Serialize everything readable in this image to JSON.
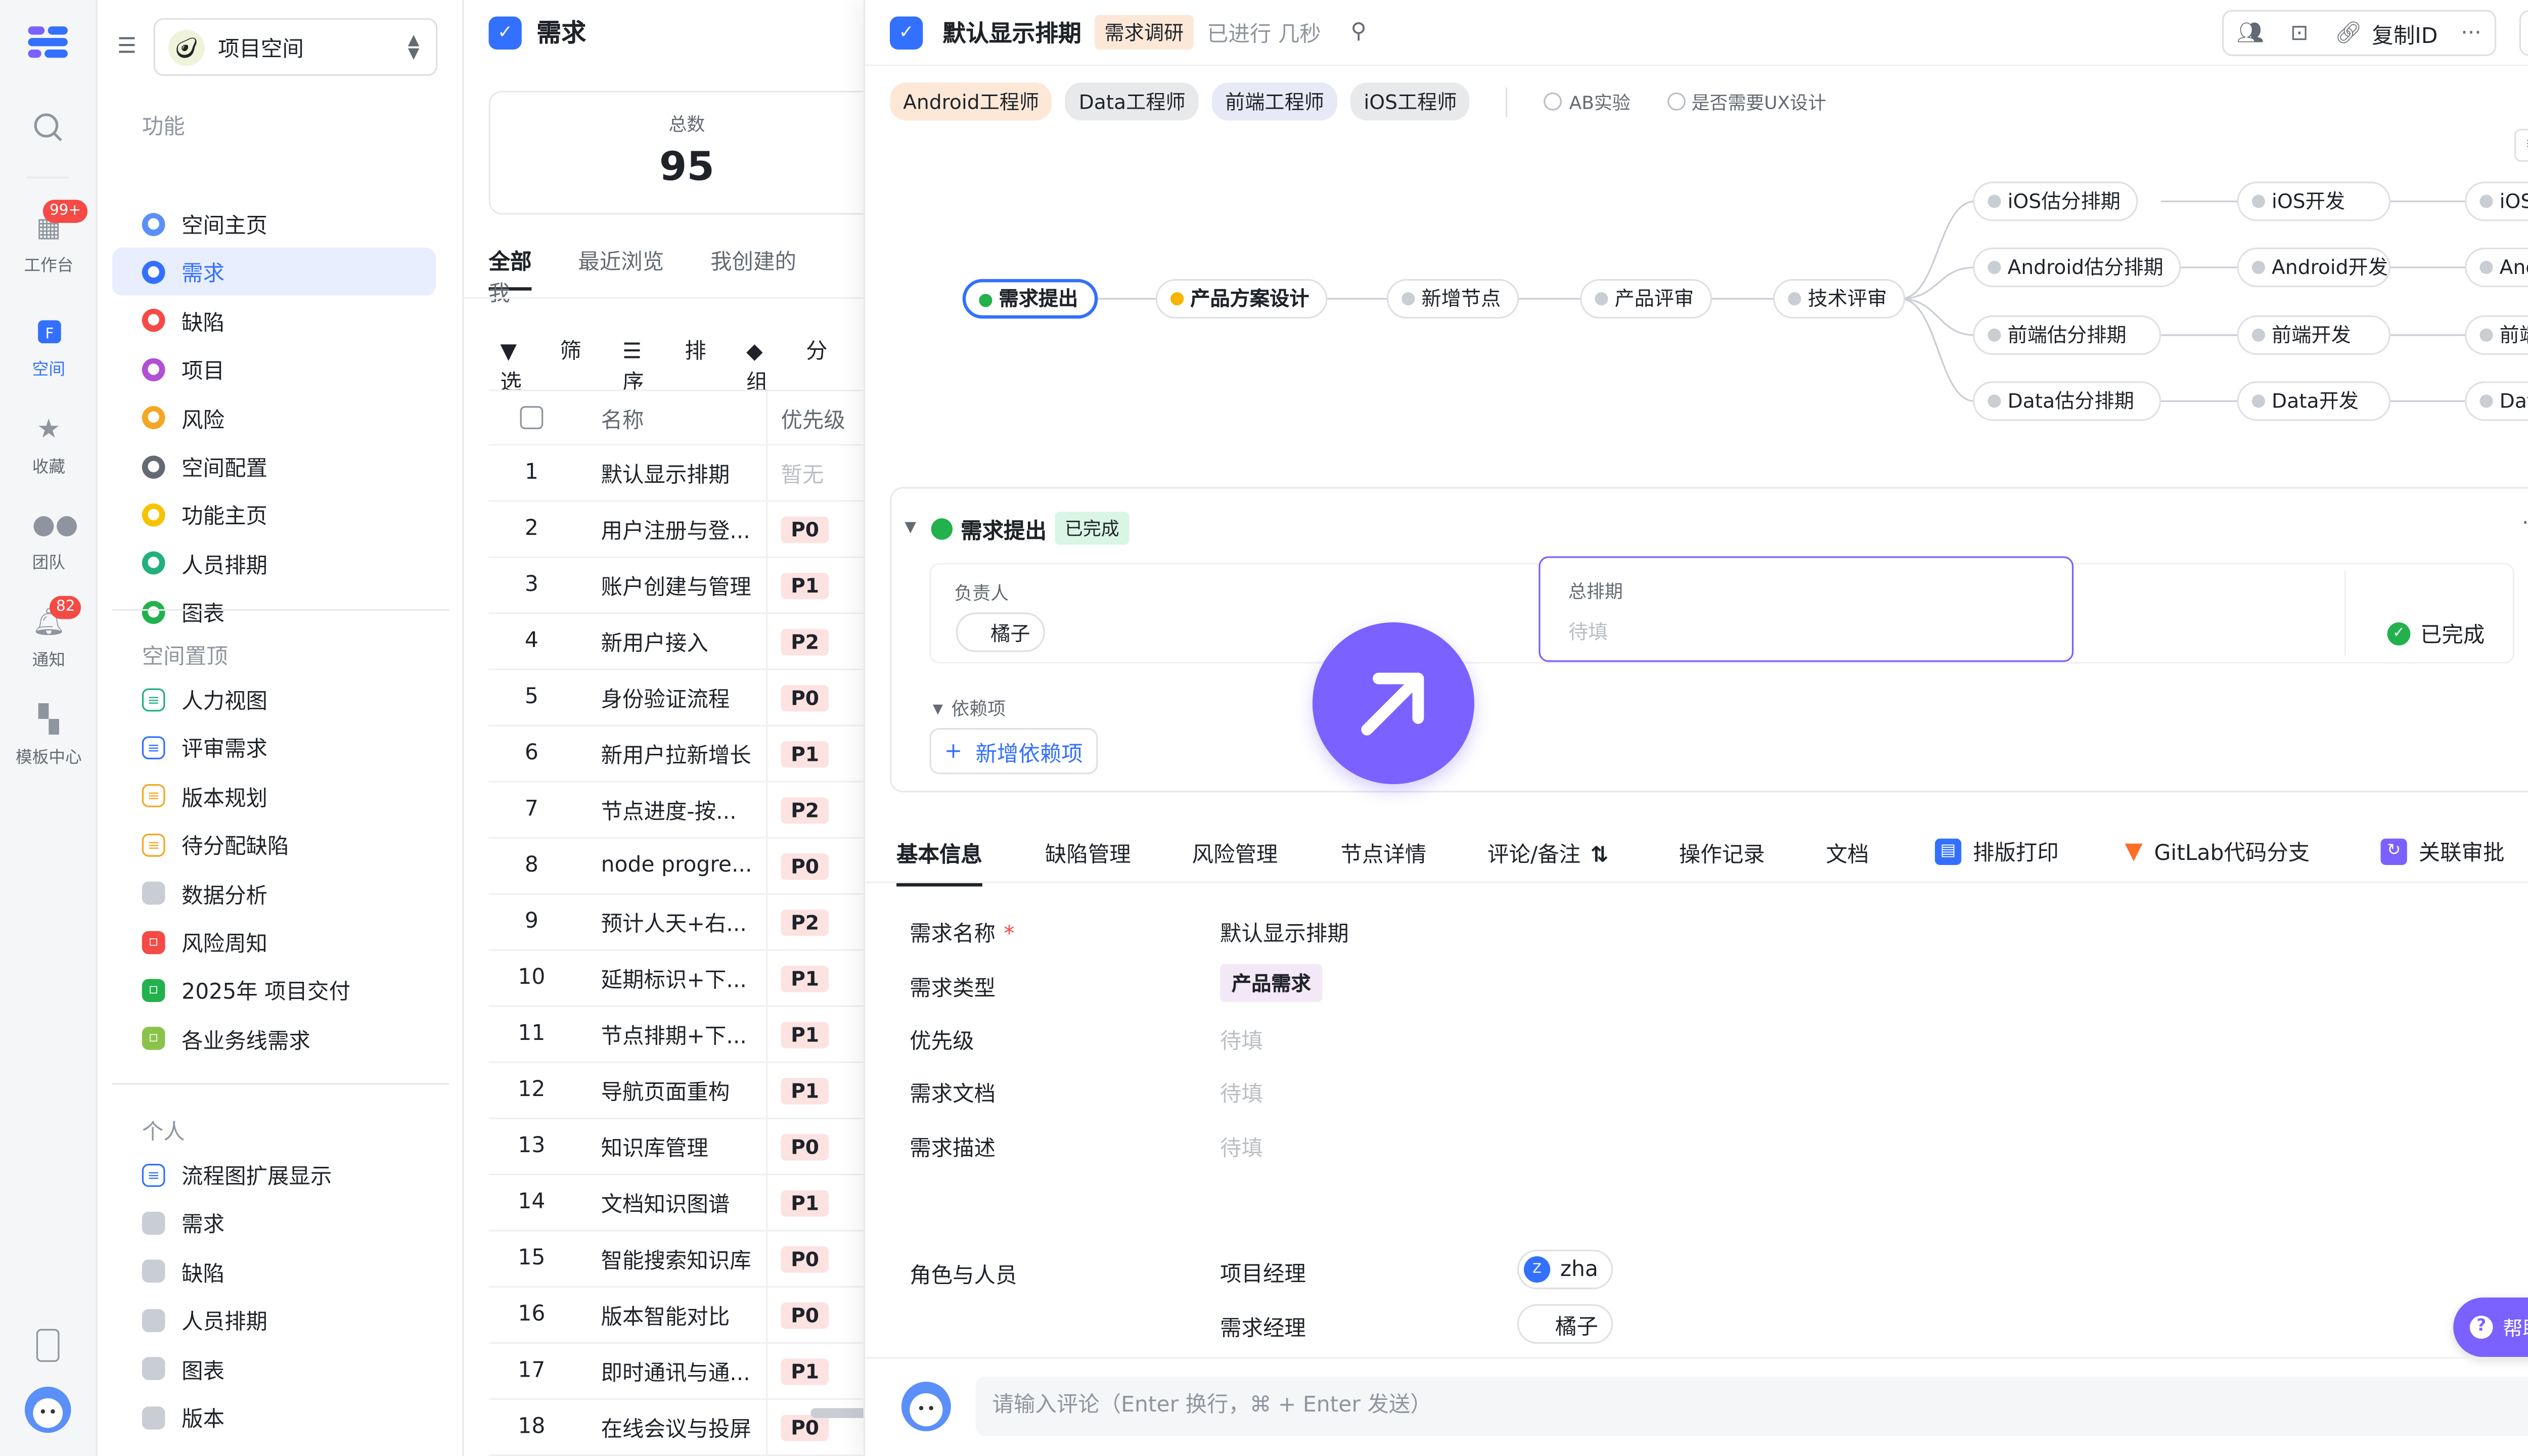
{
  "rail": {
    "items": [
      {
        "label": "工作台",
        "badge": "99+"
      },
      {
        "label": "空间"
      },
      {
        "label": "收藏"
      },
      {
        "label": "团队"
      },
      {
        "label": "通知",
        "badge": "82"
      },
      {
        "label": "模板中心"
      }
    ]
  },
  "sidebar": {
    "space_name": "项目空间",
    "sections": {
      "features": "功能",
      "pinned": "空间置顶",
      "personal": "个人"
    },
    "features": [
      {
        "label": "空间主页"
      },
      {
        "label": "需求"
      },
      {
        "label": "缺陷"
      },
      {
        "label": "项目"
      },
      {
        "label": "风险"
      },
      {
        "label": "空间配置"
      },
      {
        "label": "功能主页"
      },
      {
        "label": "人员排期"
      },
      {
        "label": "图表"
      }
    ],
    "pinned": [
      {
        "label": "人力视图"
      },
      {
        "label": "评审需求"
      },
      {
        "label": "版本规划"
      },
      {
        "label": "待分配缺陷"
      },
      {
        "label": "数据分析"
      },
      {
        "label": "风险周知"
      },
      {
        "label": "2025年 项目交付"
      },
      {
        "label": "各业务线需求"
      }
    ],
    "personal": [
      {
        "label": "流程图扩展显示"
      },
      {
        "label": "需求"
      },
      {
        "label": "缺陷"
      },
      {
        "label": "人员排期"
      },
      {
        "label": "图表"
      },
      {
        "label": "版本"
      }
    ]
  },
  "list": {
    "title": "需求",
    "stat_label": "总数",
    "stat_value": "95",
    "tabs": [
      "全部",
      "最近浏览",
      "我创建的",
      "我"
    ],
    "tools": [
      "筛选",
      "排序",
      "分组"
    ],
    "col_name": "名称",
    "col_priority": "优先级",
    "rows": [
      {
        "no": "1",
        "name": "默认显示排期",
        "pri": "暂无"
      },
      {
        "no": "2",
        "name": "用户注册与登...",
        "pri": "P0"
      },
      {
        "no": "3",
        "name": "账户创建与管理",
        "pri": "P1"
      },
      {
        "no": "4",
        "name": "新用户接入",
        "pri": "P2"
      },
      {
        "no": "5",
        "name": "身份验证流程",
        "pri": "P0"
      },
      {
        "no": "6",
        "name": "新用户拉新增长",
        "pri": "P1"
      },
      {
        "no": "7",
        "name": "节点进度-按...",
        "pri": "P2"
      },
      {
        "no": "8",
        "name": "node progre...",
        "pri": "P0"
      },
      {
        "no": "9",
        "name": "预计人天+右...",
        "pri": "P2"
      },
      {
        "no": "10",
        "name": "延期标识+下...",
        "pri": "P1"
      },
      {
        "no": "11",
        "name": "节点排期+下...",
        "pri": "P1"
      },
      {
        "no": "12",
        "name": "导航页面重构",
        "pri": "P1"
      },
      {
        "no": "13",
        "name": "知识库管理",
        "pri": "P0"
      },
      {
        "no": "14",
        "name": "文档知识图谱",
        "pri": "P1"
      },
      {
        "no": "15",
        "name": "智能搜索知识库",
        "pri": "P0"
      },
      {
        "no": "16",
        "name": "版本智能对比",
        "pri": "P0"
      },
      {
        "no": "17",
        "name": "即时通讯与通...",
        "pri": "P1"
      },
      {
        "no": "18",
        "name": "在线会议与投屏",
        "pri": "P0"
      }
    ]
  },
  "detail": {
    "title": "默认显示排期",
    "stage_chip": "需求调研",
    "elapsed": "已进行 几秒",
    "copy_id": "复制ID",
    "role_chips": [
      "Android工程师",
      "Data工程师",
      "前端工程师",
      "iOS工程师"
    ],
    "options": [
      "AB实验",
      "是否需要UX设计"
    ],
    "flow": {
      "main": [
        "需求提出",
        "产品方案设计",
        "新增节点",
        "产品评审",
        "技术评审"
      ],
      "branches": [
        [
          "iOS估分排期",
          "iOS开发",
          "iOS测试"
        ],
        [
          "Android估分排期",
          "Android开发",
          "Android测试"
        ],
        [
          "前端估分排期",
          "前端开发",
          "前端测试"
        ],
        [
          "Data估分排期",
          "Data开发",
          "Data测试"
        ]
      ]
    },
    "node_card": {
      "title": "需求提出",
      "status": "已完成",
      "owner_label": "负责人",
      "owner": "橘子",
      "schedule_label": "总排期",
      "schedule_ph": "待填",
      "done": "已完成",
      "deps_label": "依赖项",
      "add_dep": "新增依赖项"
    },
    "tabs": [
      "基本信息",
      "缺陷管理",
      "风险管理",
      "节点详情",
      "评论/备注",
      "操作记录",
      "文档",
      "排版打印",
      "GitLab代码分支",
      "关联审批"
    ],
    "form": {
      "name_label": "需求名称",
      "name_value": "默认显示排期",
      "type_label": "需求类型",
      "type_value": "产品需求",
      "priority_label": "优先级",
      "doc_label": "需求文档",
      "desc_label": "需求描述",
      "placeholder": "待填",
      "roles_label": "角色与人员",
      "pm_label": "项目经理",
      "pm_value": "zha",
      "rm_label": "需求经理",
      "rm_value": "橘子"
    },
    "comment_ph": "请输入评论（Enter 换行，⌘ + Enter 发送）",
    "help": "帮助"
  }
}
